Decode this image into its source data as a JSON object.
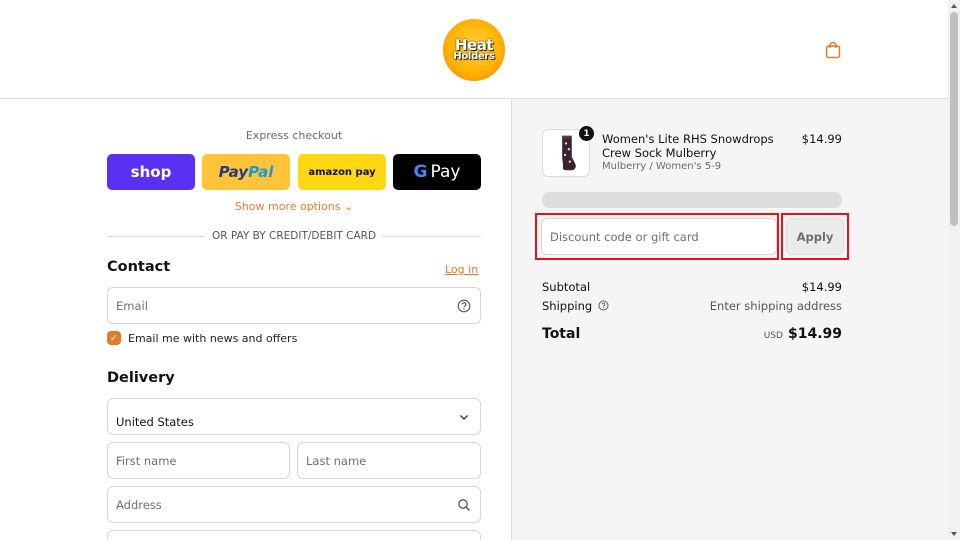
{
  "header": {
    "logo_line1": "Heat",
    "logo_line2": "Holders",
    "cart_icon": "shopping-bag-icon"
  },
  "express": {
    "label": "Express checkout",
    "buttons": {
      "shop": "shop",
      "paypal_a": "Pay",
      "paypal_b": "Pal",
      "amazon": "amazon pay",
      "gpay_g": "G",
      "gpay_text": "Pay"
    },
    "show_more": "Show more options",
    "or_label": "OR PAY BY CREDIT/DEBIT CARD"
  },
  "contact": {
    "heading": "Contact",
    "login": "Log in",
    "email_placeholder": "Email",
    "newsletter_label": "Email me with news and offers",
    "newsletter_checked": true
  },
  "delivery": {
    "heading": "Delivery",
    "country": "United States",
    "first_name_placeholder": "First name",
    "last_name_placeholder": "Last name",
    "address_placeholder": "Address"
  },
  "summary": {
    "product": {
      "quantity": "1",
      "name": "Women's Lite RHS Snowdrops Crew Sock Mulberry",
      "variant": "Mulberry / Women's 5-9",
      "price": "$14.99"
    },
    "discount_placeholder": "Discount code or gift card",
    "apply_label": "Apply",
    "subtotal_label": "Subtotal",
    "subtotal_value": "$14.99",
    "shipping_label": "Shipping",
    "shipping_value": "Enter shipping address",
    "total_label": "Total",
    "currency": "USD",
    "total_value": "$14.99"
  },
  "colors": {
    "accent": "#e37b26",
    "shop_purple": "#5a31f4",
    "paypal_yellow": "#ffc439",
    "amazon_yellow": "#ffd814",
    "highlight_red": "#e0141a"
  }
}
